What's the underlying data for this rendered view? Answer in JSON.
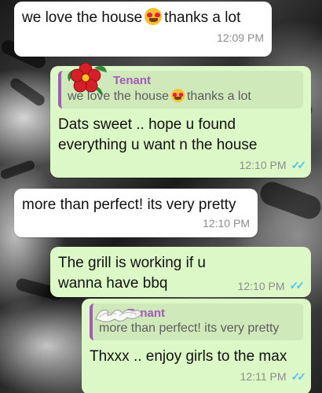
{
  "messages": [
    {
      "direction": "incoming",
      "text_before": "we love the house",
      "emoji": "heart-eyes-emoji",
      "text_after": "thanks a lot",
      "time": "12:09 PM"
    },
    {
      "direction": "outgoing",
      "quote_author": "Tenant",
      "quote_text_before": "we love the house",
      "quote_text_after": "thanks a lot",
      "text": "Dats sweet .. hope u found everything u want n the house",
      "time": "12:10 PM"
    },
    {
      "direction": "incoming",
      "text": "more than perfect! its very pretty",
      "time": "12:10 PM"
    },
    {
      "direction": "outgoing",
      "text": "The grill is working if u wanna have bbq",
      "time": "12:10 PM"
    },
    {
      "direction": "outgoing",
      "quote_author": "Tenant",
      "quote_text": "more than perfect! its very pretty",
      "text": "Thxxx .. enjoy girls to the max",
      "time": "12:11 PM"
    }
  ],
  "status_icon": "double-check-read-icon",
  "colors": {
    "incoming_bubble": "#ffffff",
    "outgoing_bubble": "#dcf8c6",
    "quote_accent": "#a45ab8",
    "read_ticks": "#4fc3f7"
  }
}
